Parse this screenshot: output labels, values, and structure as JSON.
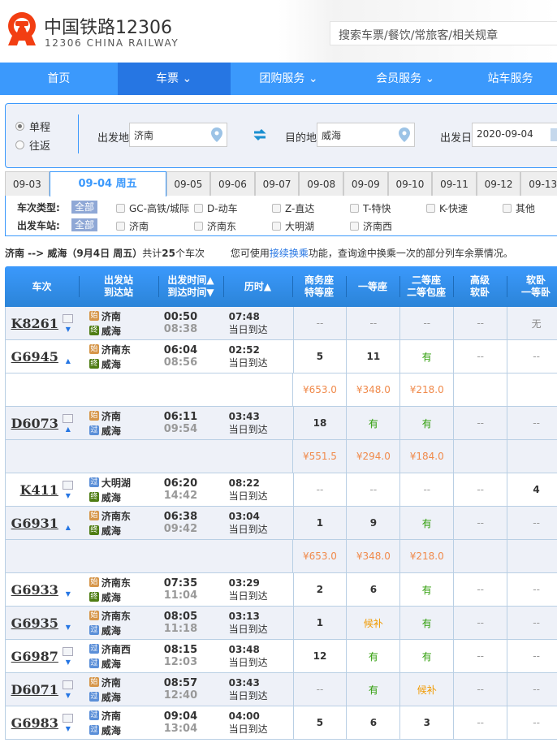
{
  "header": {
    "brand": "中国铁路12306",
    "brand_en": "12306 CHINA RAILWAY",
    "search_placeholder": "搜索车票/餐饮/常旅客/相关规章",
    "logo_color": "#f23e12"
  },
  "nav": [
    {
      "label": "首页",
      "caret": false
    },
    {
      "label": "车票",
      "caret": true,
      "active": true
    },
    {
      "label": "团购服务",
      "caret": true
    },
    {
      "label": "会员服务",
      "caret": true
    },
    {
      "label": "站车服务",
      "caret": false
    }
  ],
  "query": {
    "one_way": "单程",
    "round_trip": "往返",
    "selected": "单程",
    "from_label": "出发地",
    "from": "济南",
    "to_label": "目的地",
    "to": "威海",
    "date_label": "出发日",
    "date": "2020-09-04"
  },
  "date_tabs": [
    "09-03",
    "09-04 周五",
    "09-05",
    "09-06",
    "09-07",
    "09-08",
    "09-09",
    "09-10",
    "09-11",
    "09-12",
    "09-13"
  ],
  "active_date": "09-04 周五",
  "filters": {
    "type_label": "车次类型:",
    "station_label": "出发车站:",
    "all": "全部",
    "types": [
      "GC-高铁/城际",
      "D-动车",
      "Z-直达",
      "T-特快",
      "K-快速",
      "其他"
    ],
    "stations": [
      "济南",
      "济南东",
      "大明湖",
      "济南西"
    ]
  },
  "summary": {
    "route": "济南 --> 威海（9月4日  周五）",
    "count_pre": "共计",
    "count": "25",
    "count_post": "个车次",
    "hint_pre": "您可使用",
    "hint_link": "接续换乘",
    "hint_post": "功能，查询途中换乘一次的部分列车余票情况。"
  },
  "columns": [
    [
      "车次"
    ],
    [
      "出发站",
      "到达站"
    ],
    [
      "出发时间▲",
      "到达时间▼"
    ],
    [
      "历时▲"
    ],
    [
      "商务座",
      "特等座"
    ],
    [
      "一等座"
    ],
    [
      "二等座",
      "二等包座"
    ],
    [
      "高级",
      "软卧"
    ],
    [
      "软卧",
      "一等卧"
    ]
  ],
  "badges": {
    "始": "#d6964a",
    "过": "#5b8fd8",
    "终": "#4f7d14"
  },
  "trains": [
    {
      "no": "K8261",
      "doc": true,
      "arrow": "down",
      "from": "济南",
      "fb": "始",
      "to": "威海",
      "tb": "终",
      "dep": "00:50",
      "arr": "08:38",
      "dur": "07:48",
      "day": "当日到达",
      "seats": [
        "--",
        "--",
        "--",
        "--",
        "无"
      ]
    },
    {
      "no": "G6945",
      "doc": false,
      "arrow": "up",
      "from": "济南东",
      "fb": "始",
      "to": "威海",
      "tb": "终",
      "dep": "06:04",
      "arr": "08:56",
      "dur": "02:52",
      "day": "当日到达",
      "seats": [
        "5",
        "11",
        "有",
        "--",
        "--"
      ],
      "prices": [
        "¥653.0",
        "¥348.0",
        "¥218.0",
        "",
        ""
      ]
    },
    {
      "no": "D6073",
      "doc": true,
      "arrow": "up",
      "from": "济南",
      "fb": "始",
      "to": "威海",
      "tb": "过",
      "dep": "06:11",
      "arr": "09:54",
      "dur": "03:43",
      "day": "当日到达",
      "seats": [
        "18",
        "有",
        "有",
        "--",
        "--"
      ],
      "prices": [
        "¥551.5",
        "¥294.0",
        "¥184.0",
        "",
        ""
      ]
    },
    {
      "no": "K411",
      "doc": true,
      "arrow": "down",
      "from": "大明湖",
      "fb": "过",
      "to": "威海",
      "tb": "终",
      "dep": "06:20",
      "arr": "14:42",
      "dur": "08:22",
      "day": "当日到达",
      "seats": [
        "--",
        "--",
        "--",
        "--",
        "4"
      ]
    },
    {
      "no": "G6931",
      "doc": false,
      "arrow": "up",
      "from": "济南东",
      "fb": "始",
      "to": "威海",
      "tb": "终",
      "dep": "06:38",
      "arr": "09:42",
      "dur": "03:04",
      "day": "当日到达",
      "seats": [
        "1",
        "9",
        "有",
        "--",
        "--"
      ],
      "prices": [
        "¥653.0",
        "¥348.0",
        "¥218.0",
        "",
        ""
      ]
    },
    {
      "no": "G6933",
      "doc": false,
      "arrow": "down",
      "from": "济南东",
      "fb": "始",
      "to": "威海",
      "tb": "终",
      "dep": "07:35",
      "arr": "11:04",
      "dur": "03:29",
      "day": "当日到达",
      "seats": [
        "2",
        "6",
        "有",
        "--",
        "--"
      ]
    },
    {
      "no": "G6935",
      "doc": false,
      "arrow": "down",
      "from": "济南东",
      "fb": "始",
      "to": "威海",
      "tb": "过",
      "dep": "08:05",
      "arr": "11:18",
      "dur": "03:13",
      "day": "当日到达",
      "seats": [
        "1",
        "候补",
        "有",
        "--",
        "--"
      ]
    },
    {
      "no": "G6987",
      "doc": true,
      "arrow": "down",
      "from": "济南西",
      "fb": "过",
      "to": "威海",
      "tb": "过",
      "dep": "08:15",
      "arr": "12:03",
      "dur": "03:48",
      "day": "当日到达",
      "seats": [
        "12",
        "有",
        "有",
        "--",
        "--"
      ]
    },
    {
      "no": "D6071",
      "doc": true,
      "arrow": "down",
      "from": "济南",
      "fb": "始",
      "to": "威海",
      "tb": "过",
      "dep": "08:57",
      "arr": "12:40",
      "dur": "03:43",
      "day": "当日到达",
      "seats": [
        "--",
        "有",
        "候补",
        "--",
        "--"
      ]
    },
    {
      "no": "G6983",
      "doc": true,
      "arrow": "down",
      "from": "济南",
      "fb": "过",
      "to": "威海",
      "tb": "过",
      "dep": "09:04",
      "arr": "13:04",
      "dur": "04:00",
      "day": "当日到达",
      "seats": [
        "5",
        "6",
        "3",
        "--",
        "--"
      ]
    }
  ]
}
